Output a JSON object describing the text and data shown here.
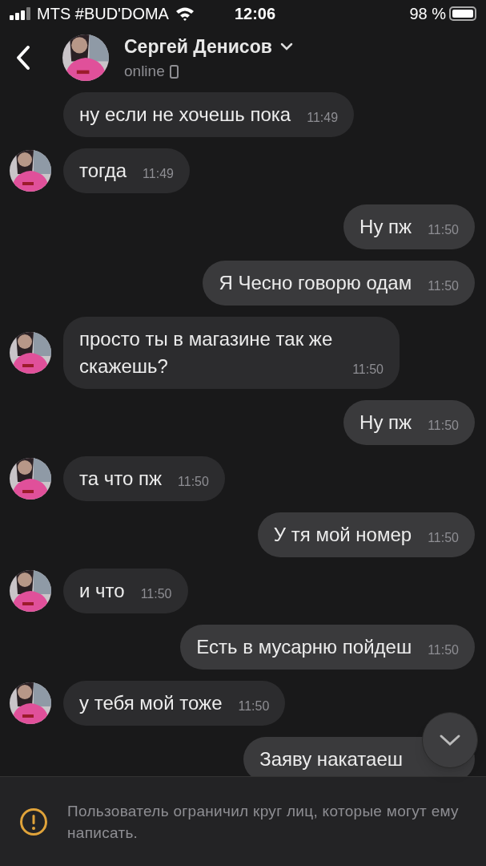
{
  "status_bar": {
    "carrier": "MTS #BUD'DOMA",
    "time": "12:06",
    "battery": "98 %"
  },
  "header": {
    "name": "Сергей Денисов",
    "status": "online"
  },
  "messages": [
    {
      "text": "ну если не хочешь пока",
      "time": "11:49",
      "outgoing": false,
      "show_avatar": false
    },
    {
      "text": "тогда",
      "time": "11:49",
      "outgoing": false,
      "show_avatar": true
    },
    {
      "text": "Ну пж",
      "time": "11:50",
      "outgoing": true
    },
    {
      "text": "Я Чесно говорю одам",
      "time": "11:50",
      "outgoing": true
    },
    {
      "text": "просто ты в магазине так же скажешь?",
      "time": "11:50",
      "outgoing": false,
      "show_avatar": true
    },
    {
      "text": "Ну пж",
      "time": "11:50",
      "outgoing": true
    },
    {
      "text": "та что пж",
      "time": "11:50",
      "outgoing": false,
      "show_avatar": true
    },
    {
      "text": "У тя мой номер",
      "time": "11:50",
      "outgoing": true
    },
    {
      "text": "и что",
      "time": "11:50",
      "outgoing": false,
      "show_avatar": true
    },
    {
      "text": "Есть в мусарню пойдеш",
      "time": "11:50",
      "outgoing": true
    },
    {
      "text": "у тебя мой тоже",
      "time": "11:50",
      "outgoing": false,
      "show_avatar": true
    },
    {
      "text": "Заяву накатаеш",
      "outgoing": true
    }
  ],
  "notice": "Пользователь ограничил круг лиц, которые могут ему написать."
}
